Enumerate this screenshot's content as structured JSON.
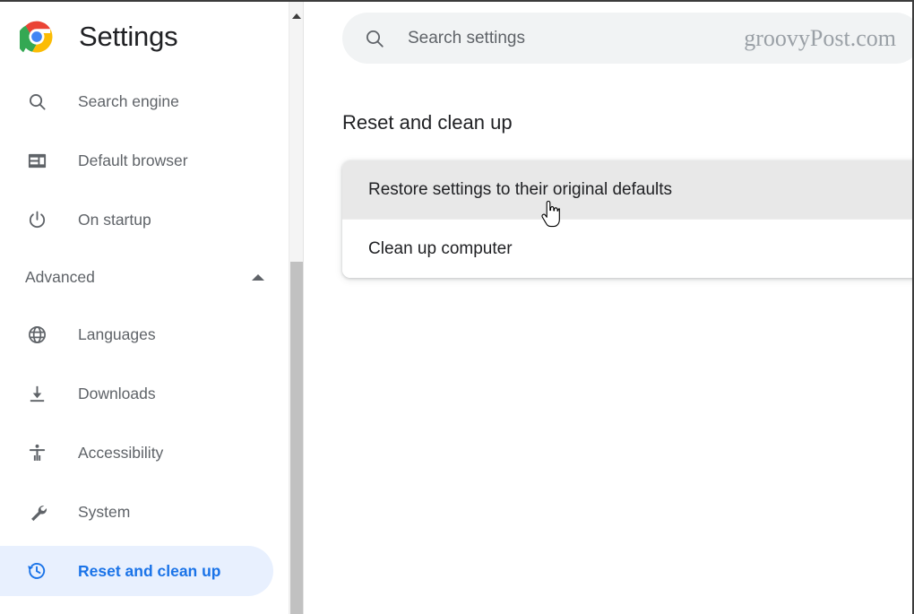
{
  "app": {
    "brand_title": "Settings",
    "logo_icon": "chrome-logo-icon",
    "watermark": "groovyPost.com"
  },
  "search": {
    "placeholder": "Search settings",
    "icon": "search-icon"
  },
  "sidebar": {
    "items": [
      {
        "label": "Search engine",
        "icon": "search-icon",
        "active": false,
        "type": "item"
      },
      {
        "label": "Default browser",
        "icon": "browser-window-icon",
        "active": false,
        "type": "item"
      },
      {
        "label": "On startup",
        "icon": "power-icon",
        "active": false,
        "type": "item"
      },
      {
        "label": "Advanced",
        "icon": "chevron-up-icon",
        "active": false,
        "type": "section"
      },
      {
        "label": "Languages",
        "icon": "globe-icon",
        "active": false,
        "type": "item"
      },
      {
        "label": "Downloads",
        "icon": "download-icon",
        "active": false,
        "type": "item"
      },
      {
        "label": "Accessibility",
        "icon": "accessibility-person-icon",
        "active": false,
        "type": "item"
      },
      {
        "label": "System",
        "icon": "wrench-icon",
        "active": false,
        "type": "item"
      },
      {
        "label": "Reset and clean up",
        "icon": "restore-history-icon",
        "active": true,
        "type": "item"
      }
    ],
    "scrollbar": {
      "up_arrow_icon": "scroll-up-arrow-icon"
    }
  },
  "main": {
    "page_title": "Reset and clean up",
    "rows": [
      {
        "label": "Restore settings to their original defaults",
        "hovered": true
      },
      {
        "label": "Clean up computer",
        "hovered": false
      }
    ]
  },
  "cursor": {
    "icon": "hand-pointer-cursor"
  },
  "colors": {
    "accent_blue": "#1a73e8",
    "active_pill_bg": "#e8f0fe",
    "text_primary": "#202124",
    "text_secondary": "#5f6368",
    "search_bg": "#f1f3f4",
    "row_hover_bg": "#e8e8e8",
    "scrollbar_thumb": "#c1c1c1"
  }
}
